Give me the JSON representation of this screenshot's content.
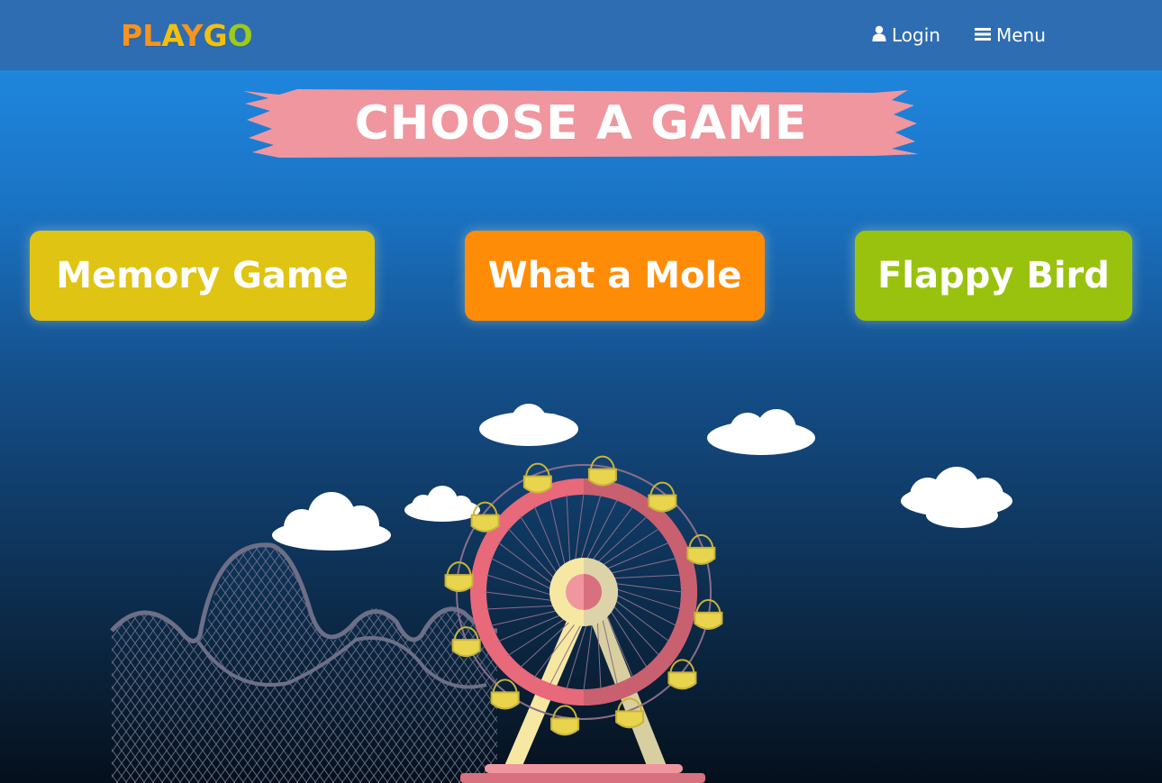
{
  "header": {
    "logo_letters": [
      {
        "char": "P",
        "color": "#f7941d"
      },
      {
        "char": "L",
        "color": "#f7941d"
      },
      {
        "char": "A",
        "color": "#f2c00f"
      },
      {
        "char": "Y",
        "color": "#f7941d"
      },
      {
        "char": "G",
        "color": "#f2c00f"
      },
      {
        "char": "O",
        "color": "#9ccb19"
      }
    ],
    "login_label": "Login",
    "login_icon": "user-icon",
    "menu_label": "Menu",
    "menu_icon": "bars-icon"
  },
  "banner": {
    "title": "CHOOSE A GAME",
    "color": "#f0969e"
  },
  "games": [
    {
      "label": "Memory Game",
      "color": "#e0c414"
    },
    {
      "label": "What a Mole",
      "color": "#ff8c06"
    },
    {
      "label": "Flappy Bird",
      "color": "#99c20e"
    }
  ],
  "illustration": {
    "elements": [
      "ferris-wheel",
      "roller-coaster",
      "clouds"
    ],
    "colors": {
      "wheel_ring": "#e8697a",
      "gondola": "#e8d44d",
      "hub": "#f6e7a3",
      "coaster": "#7a7a8f",
      "cloud": "#ffffff"
    }
  }
}
